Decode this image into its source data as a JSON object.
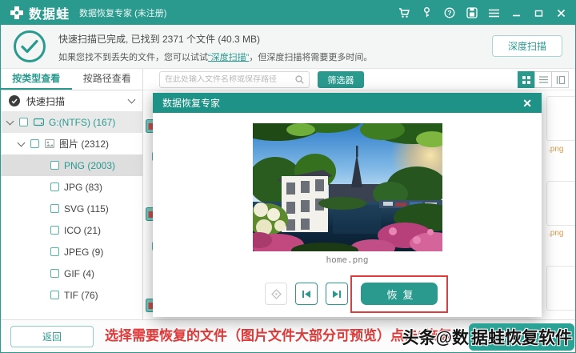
{
  "title_bar": {
    "logo": "数据蛙",
    "subtitle": "数据恢复专家 (未注册)",
    "icons": [
      "cart-icon",
      "key-icon",
      "help-icon",
      "save-icon",
      "menu-icon",
      "minimize-icon",
      "maximize-icon",
      "close-icon"
    ]
  },
  "banner": {
    "line1": "快速扫描已完成, 已找到 2371 个文件 (40.3 MB)",
    "line2_prefix": "如果您找不到丢失的文件，您可以试试",
    "line2_link": "“深度扫描”",
    "line2_suffix": "，但深度扫描将需要更多时间。",
    "deep_scan_button": "深度扫描"
  },
  "sidebar": {
    "tabs": [
      {
        "label": "按类型查看"
      },
      {
        "label": "按路径查看"
      }
    ],
    "scan_mode": "快速扫描",
    "tree": [
      {
        "label": "G:(NTFS) (167)"
      },
      {
        "label": "图片 (2312)"
      },
      {
        "label": "PNG (2003)"
      },
      {
        "label": "JPG (83)"
      },
      {
        "label": "SVG (115)"
      },
      {
        "label": "ICO (21)"
      },
      {
        "label": "JPEG (9)"
      },
      {
        "label": "GIF (4)"
      },
      {
        "label": "TIF (76)"
      }
    ]
  },
  "toolbar": {
    "search_placeholder": "在此处输入文件名称或保存路径",
    "filter_button": "筛选器",
    "view_modes": [
      "grid",
      "list",
      "detail"
    ]
  },
  "grid": {
    "right_fragments": [
      ".png",
      ".png"
    ]
  },
  "modal": {
    "title": "数据恢复专家",
    "close": "✕",
    "caption": "home.png",
    "recover_button": "恢复"
  },
  "bottom_bar": {
    "back_button": "返回",
    "hint": "选择需要恢复的文件（图片文件大部分可预览）点击“恢复”",
    "watermark_prefix": "头条@数",
    "watermark_badge": "据蛙恢复软件"
  },
  "colors": {
    "teal": "#2A9A8F",
    "modal_header": "#1F9288",
    "hint_red": "#E03A3A",
    "annotation_red": "#E23B3B",
    "filename_orange": "#D99A4E"
  }
}
